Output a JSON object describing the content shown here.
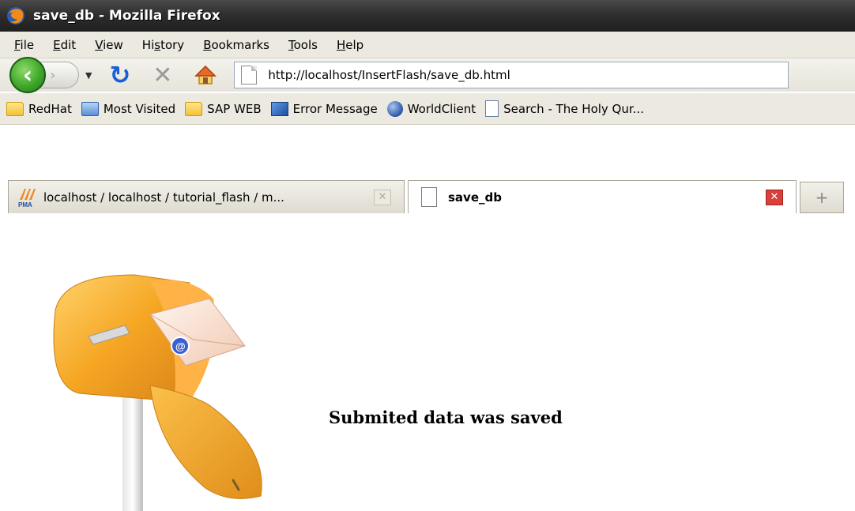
{
  "window": {
    "title": "save_db - Mozilla Firefox"
  },
  "menu": {
    "items": [
      {
        "label": "File",
        "accel": "F",
        "rest": "ile"
      },
      {
        "label": "Edit",
        "accel": "E",
        "rest": "dit"
      },
      {
        "label": "View",
        "accel": "V",
        "rest": "iew"
      },
      {
        "label": "History",
        "pre": "Hi",
        "accel": "s",
        "rest": "tory"
      },
      {
        "label": "Bookmarks",
        "accel": "B",
        "rest": "ookmarks"
      },
      {
        "label": "Tools",
        "accel": "T",
        "rest": "ools"
      },
      {
        "label": "Help",
        "accel": "H",
        "rest": "elp"
      }
    ]
  },
  "navigation": {
    "url": "http://localhost/InsertFlash/save_db.html"
  },
  "bookmarks": {
    "items": [
      {
        "label": "RedHat",
        "icon": "folder-icon"
      },
      {
        "label": "Most Visited",
        "icon": "most-visited-icon"
      },
      {
        "label": "SAP WEB",
        "icon": "folder-icon"
      },
      {
        "label": "Error Message",
        "icon": "error-message-icon"
      },
      {
        "label": "WorldClient",
        "icon": "globe-icon"
      },
      {
        "label": "Search - The Holy Qur...",
        "icon": "page-icon"
      }
    ]
  },
  "tabs": [
    {
      "label": "localhost / localhost / tutorial_flash / m...",
      "active": false
    },
    {
      "label": "save_db",
      "active": true
    }
  ],
  "page": {
    "message": "Submited data was saved"
  },
  "colors": {
    "titlebar": "#2f2f2f",
    "chrome": "#ebe9e0",
    "back_button": "#3fa82a",
    "reload_icon": "#1b5fd6",
    "tab_close_active": "#d9403a",
    "mailbox": "#f5a623"
  }
}
